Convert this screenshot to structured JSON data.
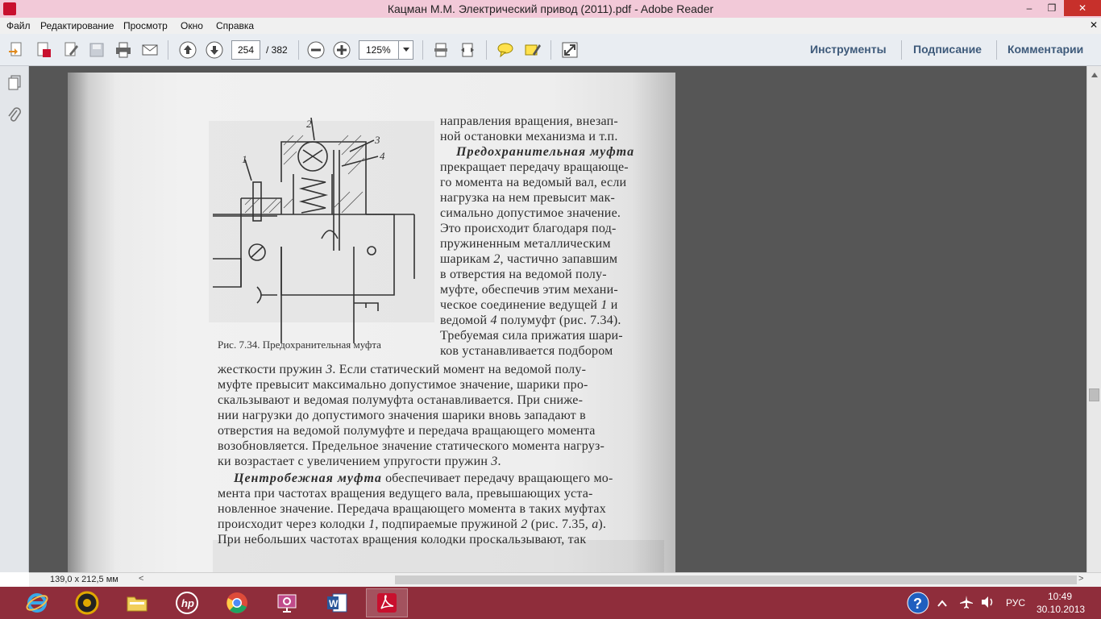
{
  "window": {
    "title": "Кацман М.М. Электрический привод (2011).pdf - Adobe Reader",
    "controls": {
      "minimize": "–",
      "maximize": "❐",
      "close": "✕"
    }
  },
  "menu": {
    "items": [
      "Файл",
      "Редактирование",
      "Просмотр",
      "Окно",
      "Справка"
    ],
    "close_doc": "✕"
  },
  "toolbar": {
    "page_current": "254",
    "page_total": "/ 382",
    "zoom": "125%",
    "right_links": [
      "Инструменты",
      "Подписание",
      "Комментарии"
    ]
  },
  "document": {
    "caption": "Рис. 7.34. Предохранительная муфта",
    "figure_labels": [
      "1",
      "2",
      "3",
      "4"
    ],
    "right_column": {
      "l1": "направления вращения, внезап-",
      "l2": "ной остановки механизма и т.п.",
      "l3_term": "Предохранительная муфта",
      "l4": "прекращает передачу вращающе-",
      "l5": "го момента на ведомый вал, если",
      "l6": "нагрузка на нем превысит мак-",
      "l7": "симально допустимое значение.",
      "l8": "Это происходит благодаря под-",
      "l9": "пружиненным металлическим",
      "l10_a": "шарикам ",
      "l10_n": "2",
      "l10_b": ", частично запавшим",
      "l11": "в отверстия на ведомой полу-",
      "l12": "муфте, обеспечив этим механи-",
      "l13_a": "ческое соединение ведущей ",
      "l13_n": "1",
      "l13_b": " и",
      "l14_a": "ведомой ",
      "l14_n": "4",
      "l14_b": " полумуфт (рис. 7.34).",
      "l15": "Требуемая сила прижатия шари-",
      "l16": "ков устанавливается подбором"
    },
    "full_width": {
      "f1_a": "жесткости пружин ",
      "f1_n": "3",
      "f1_b": ". Если статический момент на ведомой полу-",
      "f2": "муфте превысит максимально допустимое значение, шарики про-",
      "f3": "скальзывают и ведомая полумуфта останавливается. При сниже-",
      "f4": "нии нагрузки до допустимого значения шарики вновь западают в",
      "f5": "отверстия на ведомой полумуфте и передача вращающего момента",
      "f6": "возобновляется. Предельное значение статического момента нагруз-",
      "f7_a": "ки возрастает с увеличением упругости пружин ",
      "f7_n": "3",
      "f7_b": ".",
      "f8_term": "Центробежная муфта",
      "f8_b": " обеспечивает передачу вращающего мо-",
      "f9": "мента при частотах вращения ведущего вала, превышающих уста-",
      "f10": "новленное значение. Передача вращающего момента в таких муфтах",
      "f11_a": "происходит через колодки ",
      "f11_n": "1",
      "f11_b": ", подпираемые пружиной ",
      "f11_n2": "2",
      "f11_c": " (рис. 7.35, ",
      "f11_n3": "а",
      "f11_d": ").",
      "f12": "При небольших частотах вращения колодки проскальзывают, так"
    }
  },
  "statusbar": {
    "page_size": "139,0 x 212,5 мм",
    "left_arrow": "<",
    "right_arrow": ">"
  },
  "taskbar": {
    "tray": {
      "language": "РУС",
      "time": "10:49",
      "date": "30.10.2013"
    }
  },
  "colors": {
    "titlebar": "#f2c9d8",
    "taskbar": "#8f2d3b",
    "doc_bg": "#565656",
    "link": "#3e5a7a"
  }
}
